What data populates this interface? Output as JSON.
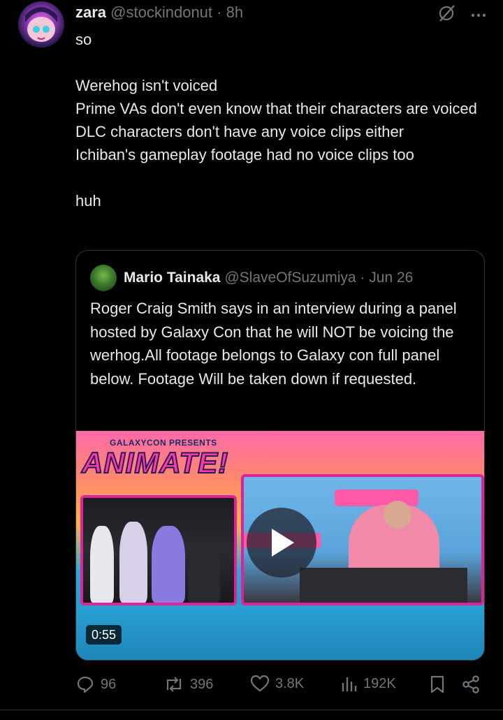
{
  "tweet": {
    "display_name": "zara",
    "handle": "@stockindonut",
    "separator": "·",
    "time": "8h",
    "body": [
      "so",
      "",
      "Werehog isn't voiced",
      "Prime VAs don't even know that their characters are voiced",
      "DLC characters don't have any voice clips either",
      "Ichiban's gameplay footage had no voice clips too",
      "",
      "huh"
    ]
  },
  "quote": {
    "display_name": "Mario Tainaka",
    "handle": "@SlaveOfSuzumiya",
    "separator": "·",
    "date": "Jun 26",
    "text": "Roger Craig Smith says in an interview during a panel hosted by Galaxy Con that he will NOT be voicing the werhog.All footage belongs to Galaxy con full panel below. Footage Will be taken down if requested.",
    "media": {
      "banner_small": "GALAXYCON PRESENTS",
      "banner_big": "ANIMATE!",
      "duration": "0:55"
    }
  },
  "actions": {
    "replies": "96",
    "reposts": "396",
    "likes": "3.8K",
    "views": "192K"
  },
  "icons": [
    "grok-icon",
    "more-icon",
    "reply-icon",
    "repost-icon",
    "like-icon",
    "views-icon",
    "bookmark-icon",
    "share-icon",
    "play-icon"
  ],
  "colors": {
    "background": "#000000",
    "text": "#e7e9ea",
    "muted": "#71767b",
    "border": "#333639",
    "accent_pink": "#e0229a"
  }
}
